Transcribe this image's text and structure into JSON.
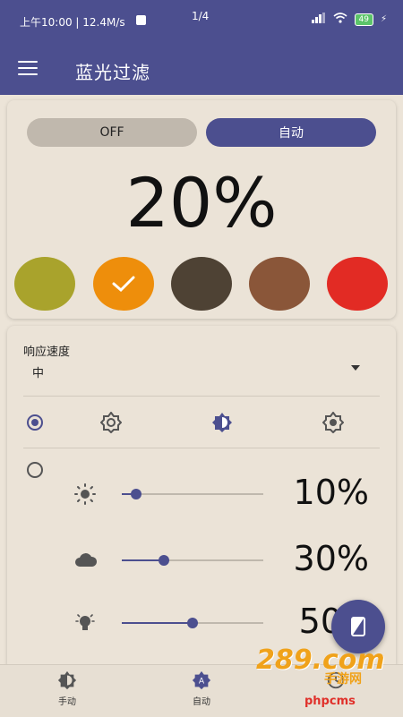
{
  "status_bar": {
    "time_speed": "上午10:00 | 12.4M/s",
    "page_counter": "1/4",
    "battery": "49"
  },
  "app_bar": {
    "title": "蓝光过滤",
    "menu_icon": "hamburger-menu-icon"
  },
  "filter_card": {
    "off_label": "OFF",
    "auto_label": "自动",
    "auto_selected": true,
    "intensity": "20%",
    "swatches": [
      {
        "name": "olive",
        "color": "#a9a32c",
        "selected": false
      },
      {
        "name": "orange",
        "color": "#ee8e0b",
        "selected": true
      },
      {
        "name": "dark-brown",
        "color": "#4e4234",
        "selected": false
      },
      {
        "name": "brown",
        "color": "#8a5639",
        "selected": false
      },
      {
        "name": "red",
        "color": "#e22b24",
        "selected": false
      }
    ]
  },
  "settings_card": {
    "response_label": "响应速度",
    "response_value": "中",
    "mode_icons": [
      "brightness-auto-icon",
      "brightness-half-icon",
      "settings-brightness-icon"
    ],
    "sliders": [
      {
        "icon": "sun-icon",
        "value": "10%",
        "level": 0.1
      },
      {
        "icon": "cloud-icon",
        "value": "30%",
        "level": 0.3
      },
      {
        "icon": "lightbulb-icon",
        "value": "50",
        "level": 0.5
      }
    ]
  },
  "bottom_nav": {
    "manual_label": "手动",
    "auto_label": "自动"
  },
  "watermark": {
    "brand": "289.com",
    "brand_cn": "手游网",
    "site": "phpcms"
  },
  "colors": {
    "accent": "#4c4f8f",
    "background": "#ece4d8",
    "pill_off": "#c0b8ad"
  }
}
